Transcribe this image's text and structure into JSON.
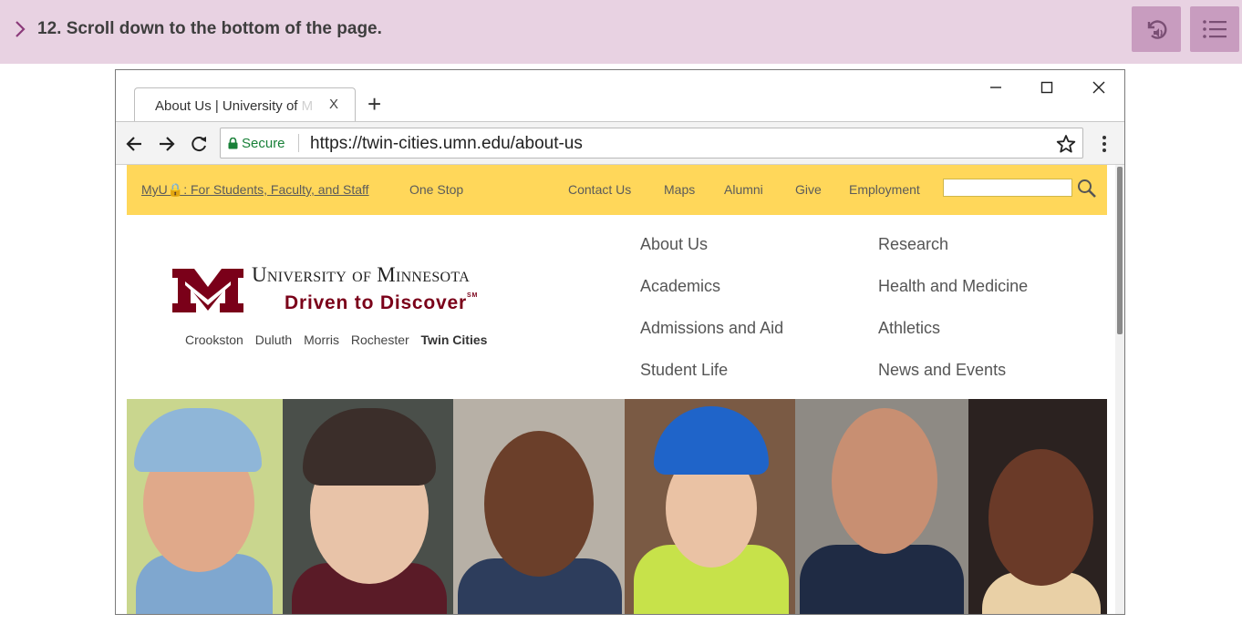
{
  "step": {
    "text": "12. Scroll down to the bottom of the page.",
    "replay_icon": "replay-audio-icon",
    "menu_icon": "list-icon"
  },
  "browser": {
    "tab": {
      "title_visible": "About Us | University of ",
      "title_fade": "M",
      "close_label": "X"
    },
    "new_tab_label": "+",
    "address": {
      "secure_label": "Secure",
      "url": "https://twin-cities.umn.edu/about-us"
    }
  },
  "page": {
    "topbar": {
      "myu": "MyU🔒: For Students, Faculty, and Staff",
      "one_stop": "One Stop",
      "contact": "Contact Us",
      "maps": "Maps",
      "alumni": "Alumni",
      "give": "Give",
      "employment": "Employment",
      "search_placeholder": ""
    },
    "logo": {
      "wordmark": "University of Minnesota",
      "tagline": "Driven to Discover",
      "tagline_mark": "SM",
      "campuses": [
        "Crookston",
        "Duluth",
        "Morris",
        "Rochester"
      ],
      "home_campus": "Twin Cities"
    },
    "nav": {
      "col1": [
        "About Us",
        "Academics",
        "Admissions and Aid",
        "Student Life"
      ],
      "col2": [
        "Research",
        "Health and Medicine",
        "Athletics",
        "News and Events"
      ]
    }
  },
  "colors": {
    "step_bar": "#e8d2e2",
    "step_button": "#c89cbf",
    "umn_gold": "#ffd75a",
    "umn_maroon": "#7a0019",
    "secure_green": "#188038"
  }
}
